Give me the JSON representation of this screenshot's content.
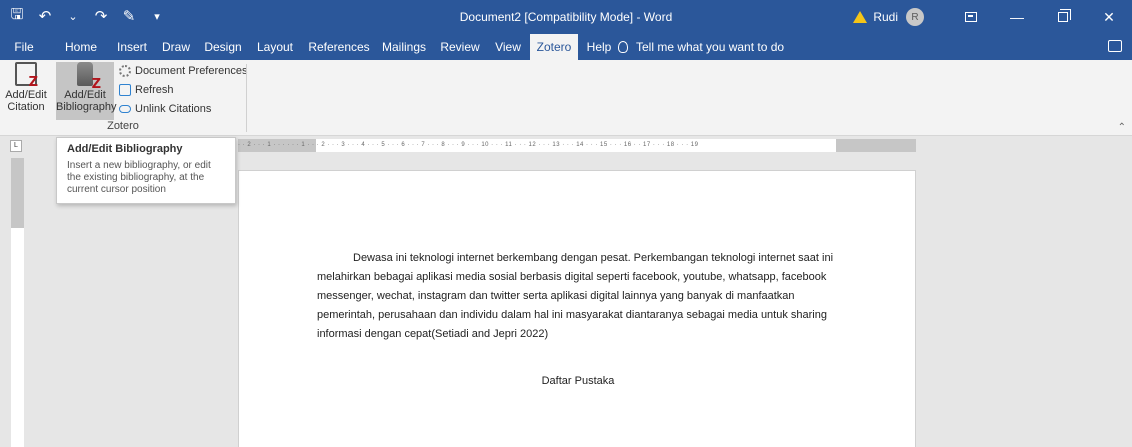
{
  "window": {
    "title": "Document2 [Compatibility Mode] - Word",
    "user": "Rudi",
    "avatar_initial": "R"
  },
  "tabs": [
    "File",
    "Home",
    "Insert",
    "Draw",
    "Design",
    "Layout",
    "References",
    "Mailings",
    "Review",
    "View",
    "Zotero",
    "Help"
  ],
  "active_tab": "Zotero",
  "tell_me": "Tell me what you want to do",
  "ribbon": {
    "add_edit_citation": [
      "Add/Edit",
      "Citation"
    ],
    "add_edit_bibliography": [
      "Add/Edit",
      "Bibliography"
    ],
    "document_preferences": "Document Preferences",
    "refresh": "Refresh",
    "unlink_citations": "Unlink Citations",
    "group_label": "Zotero"
  },
  "tooltip": {
    "title": "Add/Edit Bibliography",
    "body": "Insert a new bibliography, or edit the existing bibliography, at the current cursor position"
  },
  "ruler": {
    "tab_selector": "L",
    "ticks": "· · 2 · · · 1 · · ·   · · · 1 · · · 2 · · · 3 · · · 4 · · · 5 · · · 6 · · · 7 · · · 8 · · · 9 · · · 10 · · · 11 · · · 12 · · · 13 · · · 14 · · · 15 · · · 16 ·   · 17 · · · 18 · · · 19"
  },
  "document": {
    "paragraph": "Dewasa ini teknologi internet berkembang dengan pesat. Perkembangan teknologi internet saat ini melahirkan bebagai aplikasi media sosial berbasis digital seperti facebook, youtube, whatsapp, facebook messenger, wechat, instagram dan twitter serta aplikasi digital lainnya yang banyak di manfaatkan pemerintah, perusahaan dan individu dalam hal ini masyarakat diantaranya sebagai media untuk sharing informasi dengan cepat(Setiadi and Jepri 2022)",
    "heading": "Daftar Pustaka"
  },
  "colors": {
    "accent": "#2b579a",
    "zotero_red": "#b2151c",
    "warning": "#f5c518"
  },
  "icons": [
    "save-icon",
    "undo-icon",
    "redo-icon",
    "format-painter-icon",
    "customize-icon",
    "warning-icon",
    "ribbon-display-icon",
    "minimize-icon",
    "restore-icon",
    "close-icon",
    "lightbulb-icon",
    "comment-icon"
  ]
}
